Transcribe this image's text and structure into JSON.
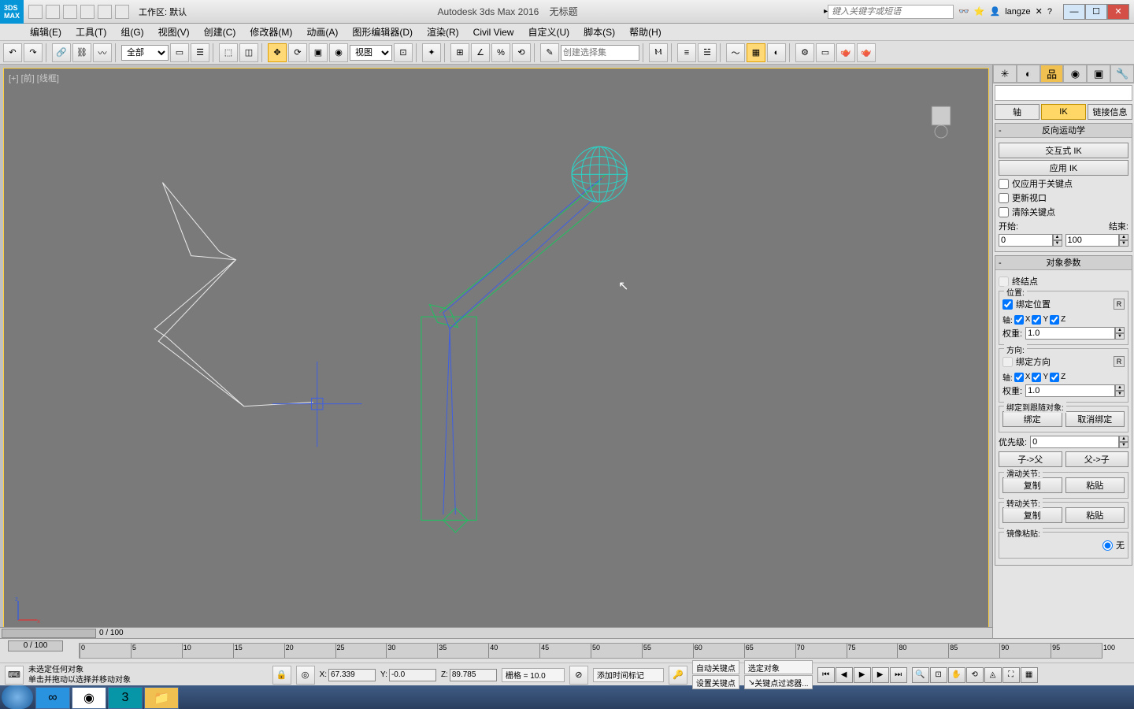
{
  "titlebar": {
    "app_badge": "3DS MAX",
    "workspace": "工作区: 默认",
    "app_title": "Autodesk 3ds Max 2016",
    "doc_title": "无标题",
    "search_placeholder": "键入关键字或短语",
    "user": "langze"
  },
  "menus": [
    "编辑(E)",
    "工具(T)",
    "组(G)",
    "视图(V)",
    "创建(C)",
    "修改器(M)",
    "动画(A)",
    "图形编辑器(D)",
    "渲染(R)",
    "Civil View",
    "自定义(U)",
    "脚本(S)",
    "帮助(H)"
  ],
  "toolbar": {
    "filter": "全部",
    "ref_frame": "视图",
    "named_set_placeholder": "创建选择集"
  },
  "viewport": {
    "label": "[+] [前] [线框]",
    "scroll_label": "0 / 100"
  },
  "rpanel": {
    "subtabs": {
      "pivot": "轴",
      "ik": "IK",
      "link": "链接信息"
    },
    "rollout_ik": {
      "title": "反向运动学",
      "btn_interactive": "交互式 IK",
      "btn_apply": "应用 IK",
      "chk_keys_only": "仅应用于关键点",
      "chk_update_vp": "更新视口",
      "chk_clear_keys": "清除关键点",
      "lbl_start": "开始:",
      "lbl_end": "结束:",
      "val_start": "0",
      "val_end": "100"
    },
    "rollout_obj": {
      "title": "对象参数",
      "chk_terminator": "终结点",
      "grp_position": "位置:",
      "chk_bind_pos": "绑定位置",
      "lbl_axis": "轴:",
      "lbl_weight": "权重:",
      "val_weight": "1.0",
      "grp_orientation": "方向:",
      "chk_bind_orient": "绑定方向",
      "grp_bind_follow": "绑定到跟随对象:",
      "btn_bind": "绑定",
      "btn_unbind": "取消绑定",
      "lbl_precedence": "优先级:",
      "val_precedence": "0",
      "btn_child_parent": "子->父",
      "btn_parent_child": "父->子",
      "grp_sliding": "滑动关节:",
      "grp_rotational": "转动关节:",
      "btn_copy": "复制",
      "btn_paste": "粘贴",
      "grp_mirror": "镜像粘贴:",
      "radio_none": "无"
    }
  },
  "timeline": {
    "slider": "0 / 100",
    "ticks": [
      0,
      5,
      10,
      15,
      20,
      25,
      30,
      35,
      40,
      45,
      50,
      55,
      60,
      65,
      70,
      75,
      80,
      85,
      90,
      95,
      100
    ]
  },
  "status": {
    "msg1": "未选定任何对象",
    "msg2": "单击并拖动以选择并移动对象",
    "x": "67.339",
    "y": "-0.0",
    "z": "89.785",
    "grid": "栅格 = 10.0",
    "add_time_tag": "添加时间标记",
    "auto_key": "自动关键点",
    "sel_obj": "选定对象",
    "set_key": "设置关键点",
    "key_filter": "关键点过滤器..."
  }
}
